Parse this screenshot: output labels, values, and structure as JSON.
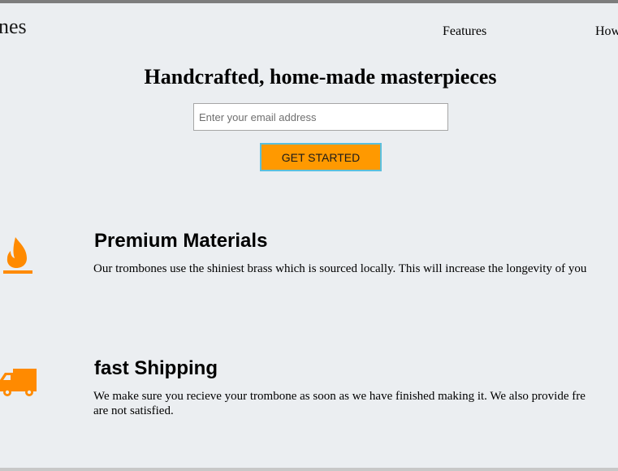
{
  "header": {
    "logo_text": "nes",
    "nav": {
      "features": "Features",
      "how": "How"
    }
  },
  "hero": {
    "title": "Handcrafted, home-made masterpieces",
    "email_placeholder": "Enter your email address",
    "cta_label": "GET STARTED"
  },
  "features": [
    {
      "icon": "fire-icon",
      "heading": "Premium Materials",
      "text": "Our trombones use the shiniest brass which is sourced locally. This will increase the longevity of you"
    },
    {
      "icon": "truck-icon",
      "heading": "fast Shipping",
      "text_line1": "We make sure you recieve your trombone as soon as we have finished making it. We also provide fre",
      "text_line2": "are not satisfied."
    }
  ],
  "colors": {
    "accent": "#ff9900",
    "button_border": "#5bc0de",
    "background": "#ebeef1"
  }
}
